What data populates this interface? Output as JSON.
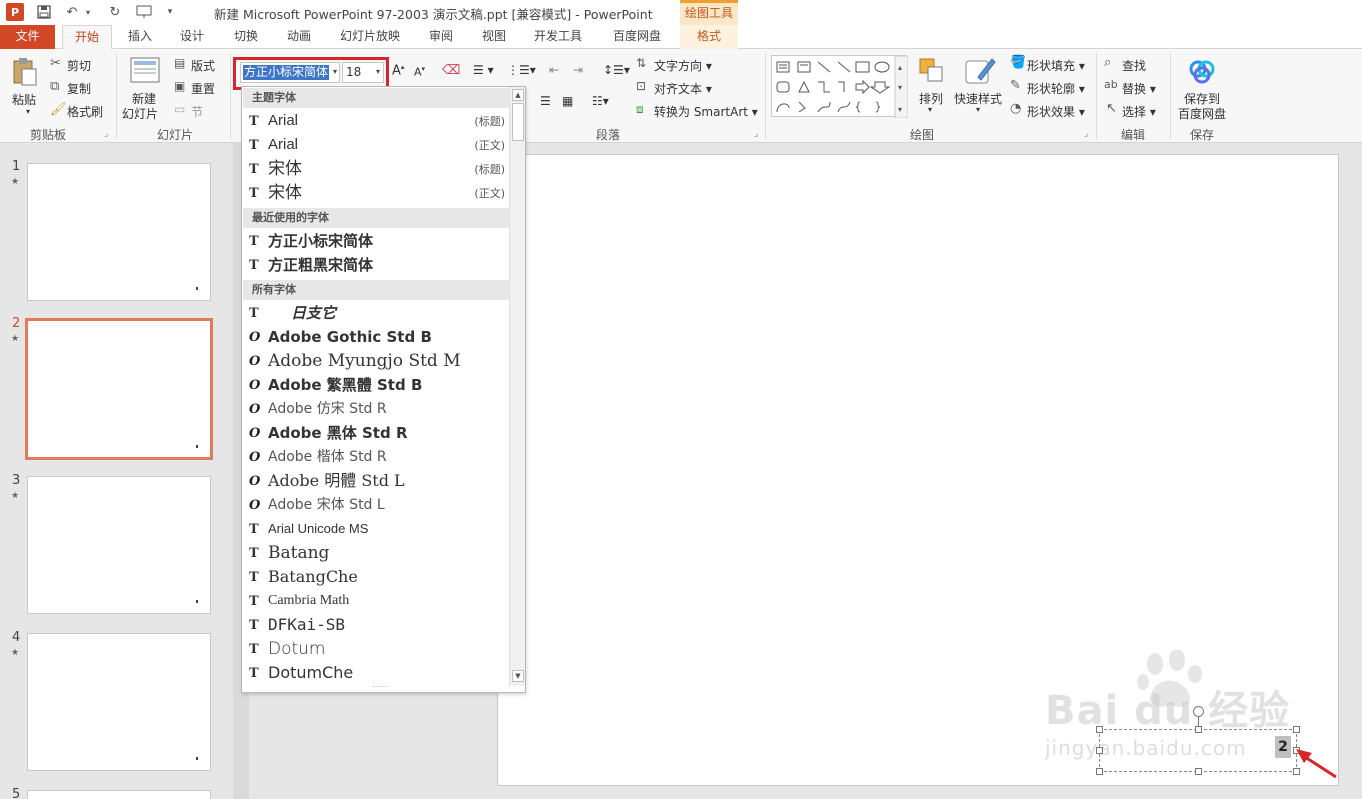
{
  "title_bar": {
    "window_title": "新建 Microsoft PowerPoint 97-2003 演示文稿.ppt [兼容模式] - PowerPoint",
    "context_group": "绘图工具"
  },
  "tabs": [
    "文件",
    "开始",
    "插入",
    "设计",
    "切换",
    "动画",
    "幻灯片放映",
    "审阅",
    "视图",
    "开发工具",
    "百度网盘",
    "格式"
  ],
  "ribbon": {
    "clipboard": {
      "paste": "粘贴",
      "cut": "剪切",
      "copy": "复制",
      "format_painter": "格式刷",
      "label": "剪贴板"
    },
    "slides": {
      "new_slide_1": "新建",
      "new_slide_2": "幻灯片",
      "layout": "版式",
      "reset": "重置",
      "section": "节",
      "label": "幻灯片"
    },
    "font": {
      "name": "方正小标宋简体",
      "size": "18"
    },
    "paragraph": {
      "text_direction": "文字方向",
      "align_text": "对齐文本",
      "smartart": "转换为 SmartArt",
      "label": "段落"
    },
    "drawing": {
      "arrange": "排列",
      "quick_styles": "快速样式",
      "fill": "形状填充",
      "outline": "形状轮廓",
      "effects": "形状效果",
      "label": "绘图"
    },
    "editing": {
      "find": "查找",
      "replace": "替换",
      "select": "选择",
      "label": "编辑"
    },
    "save": {
      "save_1": "保存到",
      "save_2": "百度网盘",
      "label": "保存"
    }
  },
  "font_dropdown": {
    "sections": {
      "theme": "主题字体",
      "recent": "最近使用的字体",
      "all": "所有字体"
    },
    "theme_fonts": [
      {
        "name": "Arial",
        "tag": "(标题)"
      },
      {
        "name": "Arial",
        "tag": "(正文)"
      },
      {
        "name": "宋体",
        "tag": "(标题)"
      },
      {
        "name": "宋体",
        "tag": "(正文)"
      }
    ],
    "recent_fonts": [
      "方正小标宋简体",
      "方正粗黑宋简体"
    ],
    "all_fonts": [
      "日支它",
      "Adobe Gothic Std B",
      "Adobe Myungjo Std M",
      "Adobe 繁黑體 Std B",
      "Adobe 仿宋 Std R",
      "Adobe 黑体 Std R",
      "Adobe 楷体 Std R",
      "Adobe 明體 Std L",
      "Adobe 宋体 Std L",
      "Arial Unicode MS",
      "Batang",
      "BatangChe",
      "Cambria Math",
      "DFKai-SB",
      "Dotum",
      "DotumChe"
    ]
  },
  "slides_pane": {
    "numbers": [
      "1",
      "2",
      "3",
      "4",
      "5"
    ],
    "selected": "2"
  },
  "slide": {
    "page_number": "2"
  },
  "watermark": {
    "brand": "Bai du 经验",
    "url": "jingyan.baidu.com"
  },
  "colors": {
    "accent": "#d24726",
    "highlight_box": "#d8242a",
    "selected_slide": "#e07b5a"
  }
}
